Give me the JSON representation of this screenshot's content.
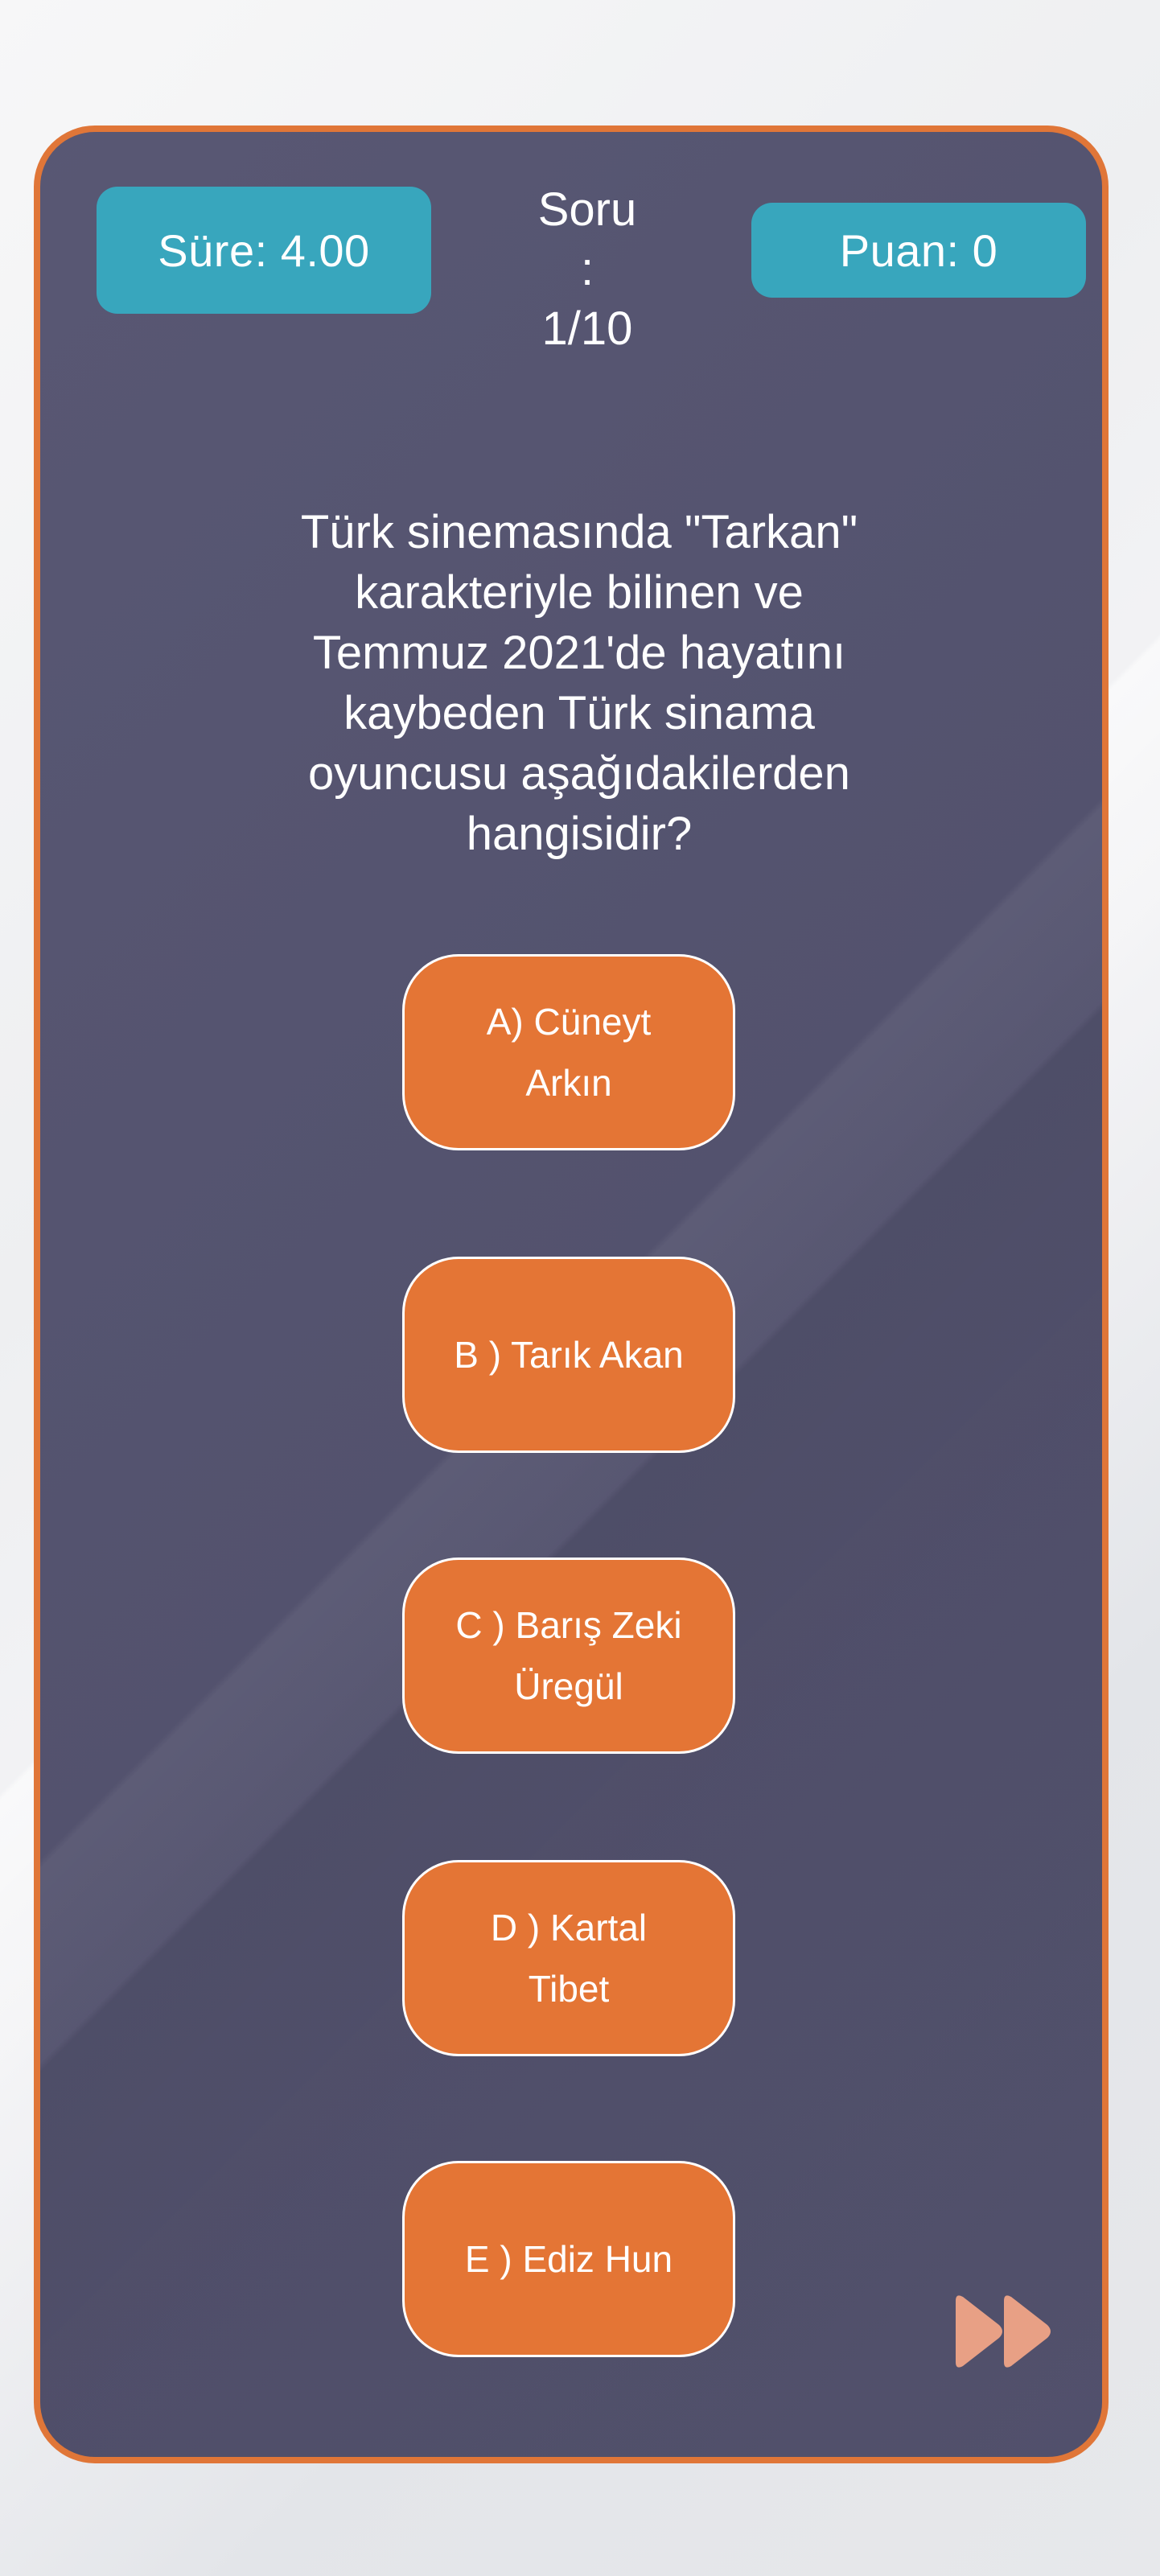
{
  "header": {
    "timer_label": "Süre: 4.00",
    "question_counter": {
      "label": "Soru",
      "separator": ":",
      "value": "1/10"
    },
    "score_label": "Puan: 0"
  },
  "question": {
    "lines": [
      "Türk sinemasında \"Tarkan\"",
      "karakteriyle bilinen ve",
      "Temmuz 2021'de hayatını",
      "kaybeden Türk sinama",
      "oyuncusu aşağıdakilerden",
      "hangisidir?"
    ]
  },
  "answers": [
    {
      "lines": [
        "A) Cüneyt",
        "Arkın"
      ]
    },
    {
      "lines": [
        "B ) Tarık Akan"
      ]
    },
    {
      "lines": [
        "C ) Barış Zeki",
        "Üregül"
      ]
    },
    {
      "lines": [
        "D ) Kartal",
        "Tibet"
      ]
    },
    {
      "lines": [
        "E ) Ediz Hun"
      ]
    }
  ],
  "icons": {
    "skip": "fast-forward-icon"
  },
  "colors": {
    "card_background": "#53526f",
    "card_border": "#e07638",
    "accent_teal": "#38a6bd",
    "answer_orange": "#e47535",
    "skip_icon": "#e8a085"
  }
}
